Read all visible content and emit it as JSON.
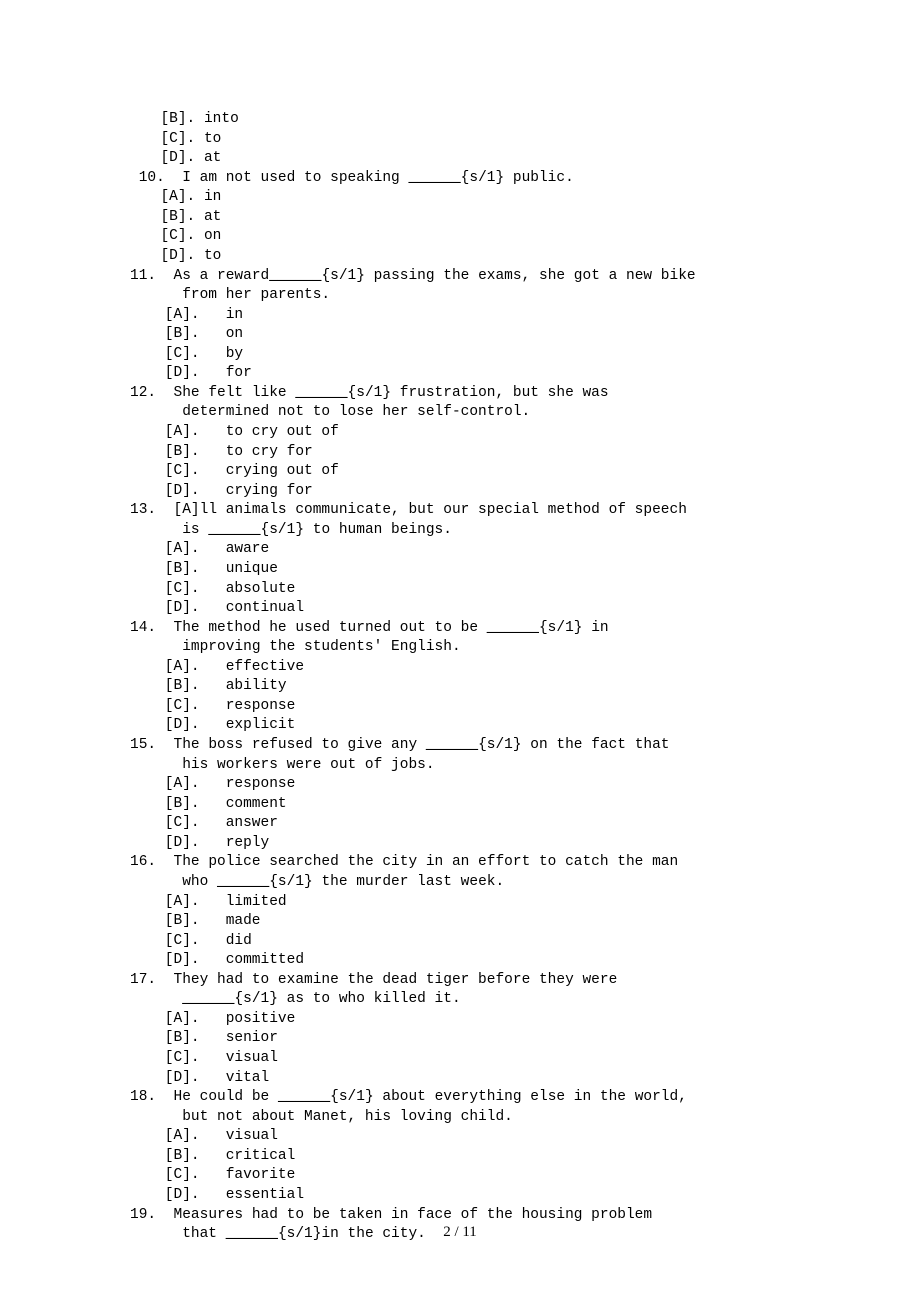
{
  "footer": "2 / 11",
  "blank_placeholder": "______",
  "tag": "{s/1}",
  "orphan_options": [
    "[B]. into",
    "[C]. to",
    "[D]. at"
  ],
  "questions": [
    {
      "num": "10",
      "num_indent": true,
      "text_parts": [
        "I am not used to speaking ",
        " public."
      ],
      "opt_indent": "indent-opt",
      "opts": [
        "[A]. in",
        "[B]. at",
        "[C]. on",
        "[D]. to"
      ]
    },
    {
      "num": "11",
      "num_indent": false,
      "text_parts": [
        "As a reward",
        " passing the exams, she got a new bike"
      ],
      "cont": [
        " from her parents."
      ],
      "opt_indent": "indent-opt2",
      "opts": [
        "[A].   in",
        "[B].   on",
        "[C].   by",
        "[D].   for"
      ]
    },
    {
      "num": "12",
      "num_indent": false,
      "text_parts": [
        "She felt like ",
        " frustration, but she was"
      ],
      "cont": [
        " determined not to lose her self-control."
      ],
      "opt_indent": "indent-opt2",
      "opts": [
        "[A].   to cry out of",
        "[B].   to cry for",
        "[C].   crying out of",
        "[D].   crying for"
      ]
    },
    {
      "num": "13",
      "num_indent": false,
      "text_parts_pre": [
        "[A]ll animals communicate, but our special method of speech"
      ],
      "cont_blank": [
        " is ",
        " to human beings."
      ],
      "opt_indent": "indent-opt2",
      "opts": [
        "[A].   aware",
        "[B].   unique",
        "[C].   absolute",
        "[D].   continual"
      ]
    },
    {
      "num": "14",
      "num_indent": false,
      "text_parts": [
        "The method he used turned out to be ",
        " in"
      ],
      "cont": [
        " improving the students' English."
      ],
      "opt_indent": "indent-opt2",
      "opts": [
        "[A].   effective",
        "[B].   ability",
        "[C].   response",
        "[D].   explicit"
      ]
    },
    {
      "num": "15",
      "num_indent": false,
      "text_parts": [
        "The boss refused to give any ",
        " on the fact that"
      ],
      "cont": [
        " his workers were out of jobs."
      ],
      "opt_indent": "indent-opt2",
      "opts": [
        "[A].   response",
        "[B].   comment",
        "[C].   answer",
        "[D].   reply"
      ]
    },
    {
      "num": "16",
      "num_indent": false,
      "text_parts_pre": [
        "The police searched the city in an effort to catch the man"
      ],
      "cont_blank": [
        " who ",
        " the murder last week."
      ],
      "opt_indent": "indent-opt2",
      "opts": [
        "[A].   limited",
        "[B].   made",
        "[C].   did",
        "[D].   committed"
      ]
    },
    {
      "num": "17",
      "num_indent": false,
      "text_parts_pre": [
        "They had to examine the dead tiger before they were"
      ],
      "cont_blank": [
        " ",
        " as to who killed it."
      ],
      "opt_indent": "indent-opt2",
      "opts": [
        "[A].   positive",
        "[B].   senior",
        "[C].   visual",
        "[D].   vital"
      ]
    },
    {
      "num": "18",
      "num_indent": false,
      "text_parts": [
        "He could be ",
        " about everything else in the world,"
      ],
      "cont": [
        " but not about Manet, his loving child."
      ],
      "opt_indent": "indent-opt2",
      "opts": [
        "[A].   visual",
        "[B].   critical",
        "[C].   favorite",
        "[D].   essential"
      ]
    },
    {
      "num": "19",
      "num_indent": false,
      "text_parts_pre": [
        "Measures had to be taken in face of the housing problem"
      ],
      "cont_blank": [
        " that ",
        "in the city."
      ],
      "opt_indent": "indent-opt2",
      "opts": []
    }
  ]
}
